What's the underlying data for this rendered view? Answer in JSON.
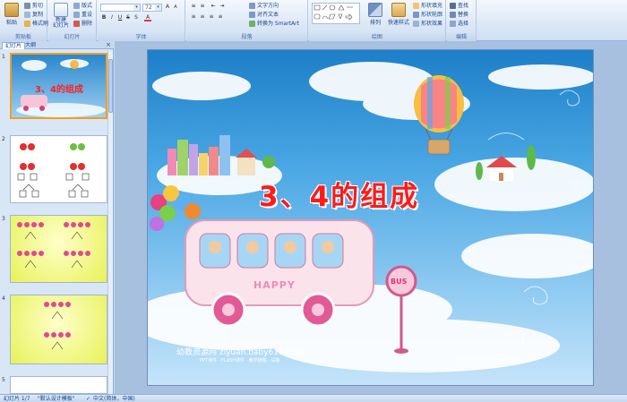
{
  "ribbon": {
    "clipboard": {
      "paste_label": "粘贴",
      "cut_label": "剪切",
      "copy_label": "复制",
      "format_painter_label": "格式刷",
      "group_label": "剪贴板"
    },
    "slides": {
      "new_slide_label": "新建\n幻灯片",
      "layout_label": "版式",
      "reset_label": "重设",
      "delete_label": "删除",
      "group_label": "幻灯片"
    },
    "font": {
      "font_size": "72",
      "group_label": "字体"
    },
    "paragraph": {
      "text_direction_label": "文字方向",
      "align_text_label": "对齐文本",
      "smartart_label": "转换为 SmartArt",
      "group_label": "段落"
    },
    "drawing": {
      "arrange_label": "排列",
      "quick_styles_label": "快速样式",
      "shape_fill_label": "形状填充",
      "shape_outline_label": "形状轮廓",
      "shape_effects_label": "形状效果",
      "group_label": "绘图"
    },
    "editing": {
      "find_label": "查找",
      "replace_label": "替换",
      "select_label": "选择",
      "group_label": "编辑"
    }
  },
  "left_panel": {
    "tab_slides": "幻灯片",
    "tab_outline": "大纲",
    "close_glyph": "×",
    "thumbnails": [
      {
        "number": "1",
        "title": "3、4的组成"
      },
      {
        "number": "2",
        "title": ""
      },
      {
        "number": "3",
        "title": ""
      },
      {
        "number": "4",
        "title": ""
      },
      {
        "number": "5",
        "title": ""
      }
    ]
  },
  "slide": {
    "title": "3、4的组成",
    "bus_text": "HAPPY",
    "sign_text": "BUS",
    "watermark": "幼教资源网 ziyuan.baby611.com",
    "watermark_sub": "PPT课件 · FLASH课件 · 教学随笔 · 试卷"
  },
  "statusbar": {
    "slide_count": "幻灯片 1/7",
    "theme": "\"默认设计模板\"",
    "language": "中文(简体，中国)"
  },
  "colors": {
    "ribbon_bg": "#dde8f6",
    "title_red": "#ff1a1a",
    "selected_border": "#f0a020",
    "sky_blue": "#4aa7e4"
  }
}
